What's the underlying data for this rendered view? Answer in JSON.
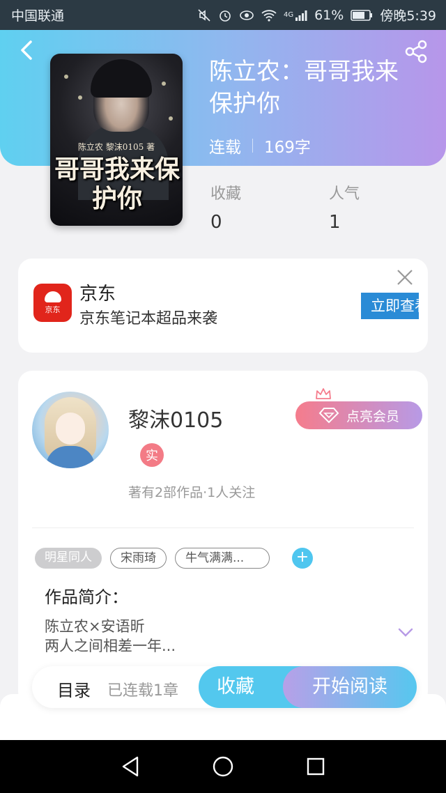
{
  "status_bar": {
    "carrier": "中国联通",
    "network": "4G",
    "battery": "61%",
    "time": "傍晚5:39"
  },
  "book": {
    "cover_small_text": "陈立农 黎沫0105 著",
    "cover_title": "哥哥我来保护你",
    "title": "陈立农：哥哥我来保护你",
    "status": "连载",
    "word_count": "169字",
    "favorites_label": "收藏",
    "favorites_value": "0",
    "popularity_label": "人气",
    "popularity_value": "1"
  },
  "ad": {
    "logo_text": "京东",
    "name": "京东",
    "description": "京东笔记本超品来袭",
    "cta": "立即查看"
  },
  "author": {
    "name": "黎沫0105",
    "verified_badge": "实",
    "stats": "著有2部作品·1人关注",
    "vip_button": "点亮会员"
  },
  "tags": [
    "明星同人",
    "宋雨琦",
    "牛气满满..."
  ],
  "tag_add": "+",
  "intro": {
    "title": "作品简介：",
    "line1": "陈立农×安语昕",
    "line2": "两人之间相差一年..."
  },
  "action_bar": {
    "toc": "目录",
    "chapters": "已连载1章",
    "collect": "收藏",
    "read": "开始阅读"
  },
  "colors": {
    "header_start": "#5fd0f0",
    "header_end": "#b796ea",
    "accent_blue": "#53c8ee",
    "vip_pink": "#f57c8c",
    "jd_red": "#e1251b"
  },
  "icons": [
    "back-arrow-icon",
    "share-icon",
    "close-icon",
    "crown-icon",
    "diamond-icon",
    "chevron-down-icon",
    "plus-icon",
    "nav-back-icon",
    "nav-home-icon",
    "nav-recent-icon"
  ]
}
